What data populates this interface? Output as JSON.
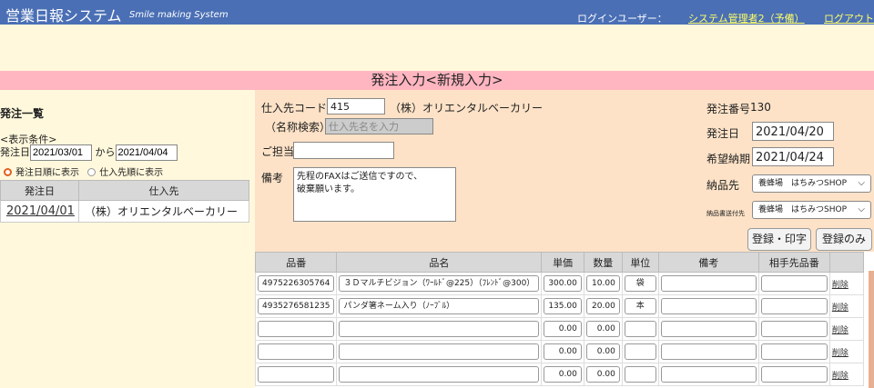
{
  "header": {
    "title": "営業日報システム",
    "subtitle": "Smile making System",
    "login_label": "ログインユーザー：",
    "user_name": "システム管理者2（予備）",
    "logout": "ログアウト"
  },
  "page_title": "発注入力<新規入力>",
  "left": {
    "section_title": "発注一覧",
    "cond_label": "<表示条件>",
    "date_label": "発注日",
    "date_from": "2021/03/01",
    "from_label": "から",
    "date_to": "2021/04/04",
    "radio1": "発注日順に表示",
    "radio2": "仕入先順に表示",
    "table_headers": [
      "発注日",
      "仕入先"
    ],
    "rows": [
      [
        "2021/04/01",
        "（株）オリエンタルベーカリー"
      ]
    ]
  },
  "form": {
    "supplier_code_label": "仕入先コード",
    "supplier_code": "415",
    "supplier_name": "（株）オリエンタルベーカリー",
    "name_search_label": "（名称検索）",
    "name_search_placeholder": "仕入先名を入力",
    "contact_label": "ご担当",
    "contact_value": "",
    "memo_label": "備考",
    "memo_line1": "先程のFAXはご送信ですので、",
    "memo_line2": "破棄願います。",
    "order_no_label": "発注番号",
    "order_no": "130",
    "order_date_label": "発注日",
    "order_date": "2021/04/20",
    "delivery_date_label": "希望納期",
    "delivery_date": "2021/04/24",
    "ship_to_label": "納品先",
    "ship_to": "養蜂場　はちみつSHOP",
    "slip_to_label": "納品書送付先",
    "slip_to": "養蜂場　はちみつSHOP",
    "btn_register_print": "登録・印字",
    "btn_register_only": "登録のみ"
  },
  "grid": {
    "headers": [
      "品番",
      "品名",
      "単価",
      "数量",
      "単位",
      "備考",
      "相手先品番",
      ""
    ],
    "delete_label": "削除",
    "rows": [
      {
        "code": "4975226305764",
        "name": "３Ｄマルチビジョン（ﾜｰﾙﾄﾞ@225）（ﾌﾚﾝﾄﾞ@300）",
        "price": "300.00",
        "qty": "10.00",
        "unit": "袋",
        "memo": "",
        "partner": ""
      },
      {
        "code": "4935276581235",
        "name": "パンダ箸ネーム入り（ﾉｰﾌﾞﾙ）",
        "price": "135.00",
        "qty": "20.00",
        "unit": "本",
        "memo": "",
        "partner": ""
      },
      {
        "code": "",
        "name": "",
        "price": "0.00",
        "qty": "0.00",
        "unit": "",
        "memo": "",
        "partner": ""
      },
      {
        "code": "",
        "name": "",
        "price": "0.00",
        "qty": "0.00",
        "unit": "",
        "memo": "",
        "partner": ""
      },
      {
        "code": "",
        "name": "",
        "price": "0.00",
        "qty": "0.00",
        "unit": "",
        "memo": "",
        "partner": ""
      }
    ]
  }
}
